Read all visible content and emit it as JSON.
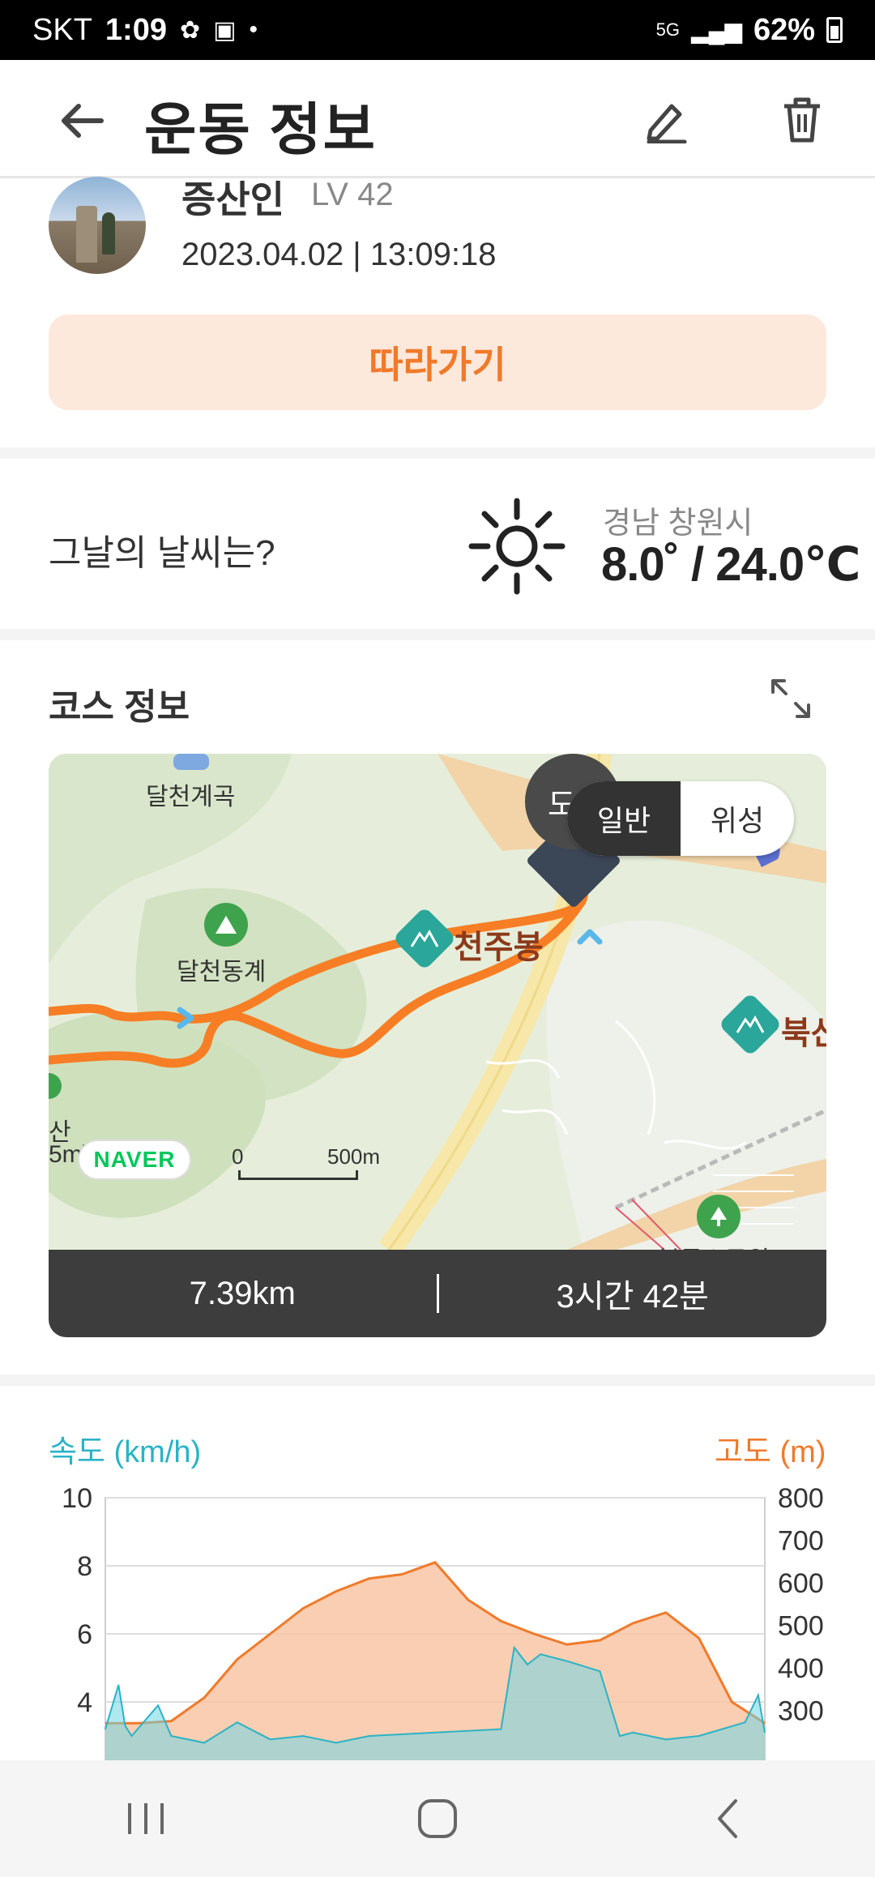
{
  "status_bar": {
    "carrier": "SKT",
    "time": "1:09",
    "network": "5G",
    "battery": "62%"
  },
  "header": {
    "title": "운동 정보"
  },
  "profile": {
    "name": "증산인",
    "level": "LV 42",
    "datetime": "2023.04.02 | 13:09:18",
    "follow_label": "따라가기"
  },
  "weather": {
    "question": "그날의 날씨는?",
    "region": "경남 창원시",
    "temperature": "8.0˚ / 24.0℃",
    "icon": "sun-icon"
  },
  "course": {
    "title": "코스 정보",
    "map": {
      "toggle_options": [
        "일반",
        "위성"
      ],
      "toggle_selected": "일반",
      "overlay_char": "도",
      "labels": {
        "valley": "달천계곡",
        "east_valley": "달천동계",
        "peak": "천주봉",
        "north_peak": "북산",
        "left_edge_mountain": "산",
        "left_edge_height": "5m)",
        "park": "북동소공원"
      },
      "naver": "NAVER",
      "scale_zero": "0",
      "scale_value": "500m"
    },
    "distance": "7.39km",
    "duration": "3시간 42분"
  },
  "chart": {
    "left_title": "속도 (km/h)",
    "right_title": "고도 (m)",
    "left_ticks": [
      "10",
      "8",
      "6",
      "4"
    ],
    "right_ticks": [
      "800",
      "700",
      "600",
      "500",
      "400",
      "300"
    ]
  },
  "chart_data": {
    "type": "area",
    "xlabel": "",
    "series": [
      {
        "name": "고도 (m)",
        "axis": "right",
        "color": "#f07a2a",
        "x": [
          0,
          5,
          10,
          15,
          20,
          25,
          30,
          35,
          40,
          45,
          50,
          55,
          60,
          65,
          70,
          75,
          80,
          85,
          90,
          95,
          100
        ],
        "values": [
          270,
          270,
          275,
          330,
          420,
          480,
          540,
          580,
          610,
          620,
          648,
          560,
          510,
          480,
          455,
          465,
          505,
          530,
          470,
          320,
          270
        ]
      },
      {
        "name": "속도 (km/h)",
        "axis": "left",
        "color": "#2ab3c6",
        "x": [
          0,
          2,
          3,
          4,
          8,
          10,
          15,
          20,
          25,
          30,
          35,
          40,
          60,
          62,
          64,
          66,
          70,
          75,
          78,
          80,
          85,
          90,
          97,
          99,
          100
        ],
        "values": [
          3.2,
          4.5,
          3.3,
          3.0,
          3.9,
          3.0,
          2.8,
          3.4,
          2.9,
          3.0,
          2.8,
          3.0,
          3.2,
          5.6,
          5.1,
          5.4,
          5.2,
          4.9,
          3.0,
          3.1,
          2.9,
          3.0,
          3.4,
          4.2,
          3.1
        ]
      }
    ],
    "ylim_left": [
      0,
      10
    ],
    "ylim_right": [
      0,
      800
    ],
    "grid": true
  }
}
